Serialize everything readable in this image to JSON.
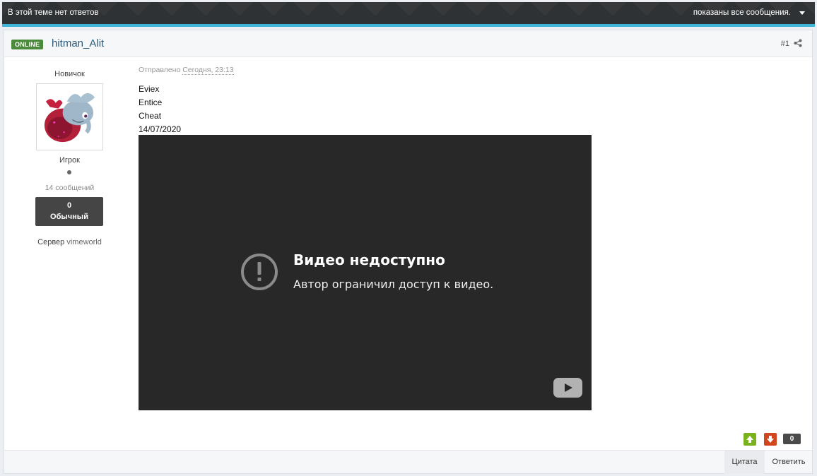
{
  "topbar": {
    "no_replies": "В этой теме нет ответов",
    "filter_label": "показаны все сообщения."
  },
  "post": {
    "status_badge": "ONLINE",
    "author": "hitman_Alit",
    "number": "#1",
    "meta_prefix": "Отправлено",
    "meta_date": "Сегодня, 23:13",
    "lines": [
      "Eviex",
      "Entice",
      "Cheat",
      "14/07/2020"
    ],
    "video": {
      "error_title": "Видео недоступно",
      "error_desc": "Автор ограничил доступ к видео."
    },
    "rating": "0"
  },
  "author_info": {
    "rank_title": "Новичок",
    "group": "Игрок",
    "post_count": "14 сообщений",
    "reputation_value": "0",
    "reputation_label": "Обычный",
    "server_label": "Сервер",
    "server_value": "vimeworld"
  },
  "footer": {
    "quote_label": "Цитата",
    "reply_label": "Ответить"
  },
  "colors": {
    "topbar_bg": "#2f3234",
    "topbar_accent": "#3fb5d8",
    "online_badge": "#4b8b3b",
    "vote_up": "#79b21c",
    "vote_down": "#d2461e",
    "author_link": "#2d5a7b"
  }
}
